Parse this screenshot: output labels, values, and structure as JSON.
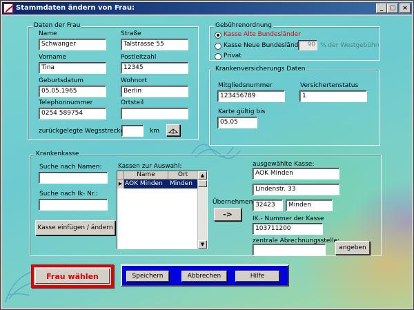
{
  "window": {
    "title": "Stammdaten ändern von Frau:"
  },
  "frau": {
    "legend": "Daten der Frau",
    "name_label": "Name",
    "name": "Schwanger",
    "strasse_label": "Straße",
    "strasse": "Talstrasse 55",
    "vorname_label": "Vorname",
    "vorname": "Tina",
    "plz_label": "Postleitzahl",
    "plz": "12345",
    "geburtsdatum_label": "Geburtsdatum",
    "geburtsdatum": "05.05.1965",
    "wohnort_label": "Wohnort",
    "wohnort": "Berlin",
    "telefon_label": "Telephonnummer",
    "telefon": "0254 589754",
    "ortsteil_label": "Ortsteil",
    "ortsteil": "",
    "wegstrecke_label": "zurückgelegte Wegsstrecke:",
    "wegstrecke": "",
    "km_label": "km"
  },
  "gebuehren": {
    "legend": "Gebührenordnung",
    "option1": "Kasse Alte Bundesländer",
    "option2": "Kasse Neue Bundesländer:",
    "percent": "90",
    "percent_suffix": "% der Westgebühren",
    "option3": "Privat",
    "selected": 1,
    "active_color": "#e00000"
  },
  "kv": {
    "legend": "Krankenversicherungs Daten",
    "mitglied_label": "Mitgliedsnummer",
    "mitglied": "123456789",
    "status_label": "Versichertenstatus",
    "status": "1",
    "karte_label": "Karte gültig bis",
    "karte": "05.05"
  },
  "kasse": {
    "legend": "Krankenkasse",
    "suche_name_label": "Suche nach Namen:",
    "suche_name": "",
    "suche_ik_label": "Suche nach Ik- Nr.:",
    "suche_ik": "",
    "einfuegen_button": "Kasse einfügen / ändern",
    "auswahl_label": "Kassen zur Auswahl:",
    "columns": [
      "Name",
      "Ort"
    ],
    "rows": [
      {
        "name": "AOK Minden",
        "ort": "Minden"
      }
    ],
    "uebernehmen_label": "Übernehmen",
    "arrow_button": "->",
    "ausgewaehlt_label": "ausgewählte Kasse:",
    "ausgewaehlt_name": "AOK Minden",
    "ausgewaehlt_strasse": "Lindenstr. 33",
    "ausgewaehlt_plz": "32423",
    "ausgewaehlt_ort": "Minden",
    "ik_label": "IK.- Nummer der Kasse",
    "ik": "103711200",
    "abrechnung_label": "zentrale Abrechnungsstelle:",
    "abrechnung": "",
    "angeben_button": "angeben",
    "selection_color": "#0a246a"
  },
  "footer": {
    "frau_waehlen": "Frau wählen",
    "frau_color": "#e00000",
    "speichern": "Speichern",
    "abbrechen": "Abbrechen",
    "hilfe": "Hilfe",
    "panel_color": "#0000e0"
  }
}
